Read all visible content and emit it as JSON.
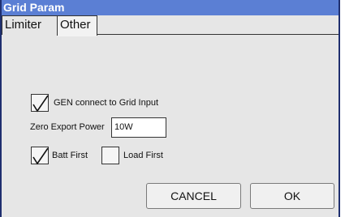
{
  "window": {
    "title": "Grid Param"
  },
  "tabs": [
    {
      "label": "Limiter"
    },
    {
      "label": "Other"
    }
  ],
  "gen_connect": {
    "label": "GEN connect to Grid Input",
    "checked": true
  },
  "zero_export": {
    "label": "Zero Export Power",
    "value": "10W"
  },
  "batt_first": {
    "label": "Batt First",
    "checked": true
  },
  "load_first": {
    "label": "Load First",
    "checked": false
  },
  "buttons": {
    "cancel": "CANCEL",
    "ok": "OK"
  }
}
